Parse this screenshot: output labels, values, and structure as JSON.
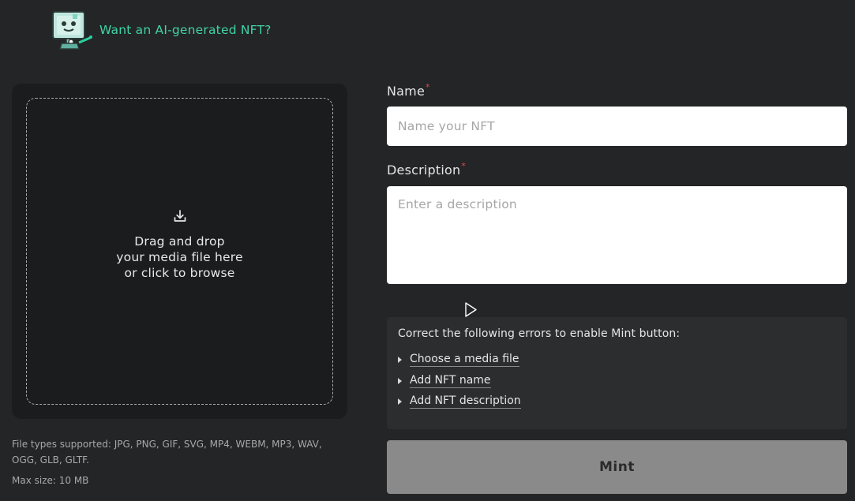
{
  "banner": {
    "text": "Want an AI-generated NFT?",
    "icon": "robot-mascot-icon",
    "accent_color": "#41d3a8"
  },
  "dropzone": {
    "icon": "download-icon",
    "line1": "Drag and drop",
    "line2": "your media file here",
    "line3": "or click to browse",
    "file_types": "File types supported: JPG, PNG, GIF, SVG, MP4, WEBM, MP3, WAV, OGG, GLB, GLTF.",
    "max_size": "Max size: 10 MB"
  },
  "form": {
    "name_label": "Name",
    "name_placeholder": "Name your NFT",
    "description_label": "Description",
    "description_placeholder": "Enter a description",
    "required_marker": "*",
    "required_color": "#e5484d"
  },
  "errors": {
    "title": "Correct the following errors to enable Mint button:",
    "items": [
      "Choose a media file",
      "Add NFT name",
      "Add NFT description"
    ]
  },
  "mint_button": {
    "label": "Mint",
    "disabled": true
  }
}
